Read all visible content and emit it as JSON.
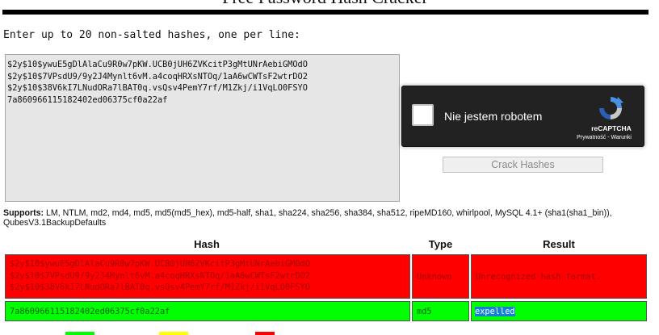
{
  "page": {
    "title": "Free Password Hash Cracker",
    "instructions": "Enter up to 20 non-salted hashes, one per line:"
  },
  "hash_input": {
    "value": "$2y$10$ywuE5gDlAlaCu9R0w7pKW.UCB0jUH6ZVKcitP3gMtUNrAebiGMOdO\n$2y$10$7VPsdU9/9y2J4Mynlt6vM.a4coqHRXsNTOq/1aA6wCWTsF2wtrDO2\n$2y$10$38V6kI7LNudORa7lBAT0q.vsQsv4PemY7rf/M1Zkj/i1VqLO0FSYO\n7a860966115182402ed06375cf0a22af"
  },
  "recaptcha": {
    "checkbox_label": "Nie jestem robotem",
    "brand": "reCAPTCHA",
    "links": "Prywatność - Warunki"
  },
  "crack_button": {
    "label": "Crack Hashes"
  },
  "supports": {
    "label": "Supports:",
    "text": " LM, NTLM, md2, md4, md5, md5(md5_hex), md5-half, sha1, sha224, sha256, sha384, sha512, ripeMD160, whirlpool, MySQL 4.1+ (sha1(sha1_bin)), QubesV3.1BackupDefaults"
  },
  "results": {
    "headers": {
      "hash": "Hash",
      "type": "Type",
      "result": "Result"
    },
    "rows": [
      {
        "hash": "$2y$10$ywuE5gDlAlaCu9R0w7pKW.UCB0jUH6ZVKcitP3gMtUNrAebiGMOdO\n$2y$10$7VPsdU9/9y2J4Mynlt6vM.a4coqHRXsNTOq/1aA6wCWTsF2wtrDO2\n$2y$10$38V6kI7LNudORa7lBAT0q.vsQsv4PemY7rf/M1Zkj/i1VqLO0FSYO",
        "type": "Unknown",
        "result": "Unrecognized hash format.",
        "status_color": "#ff0000"
      },
      {
        "hash": "7a860966115182402ed06375cf0a22af",
        "type": "md5",
        "result": "expelled",
        "status_color": "#00ff00"
      }
    ]
  },
  "legend": {
    "colors": [
      "#00ff00",
      "#ffff00",
      "#ff0000"
    ]
  }
}
